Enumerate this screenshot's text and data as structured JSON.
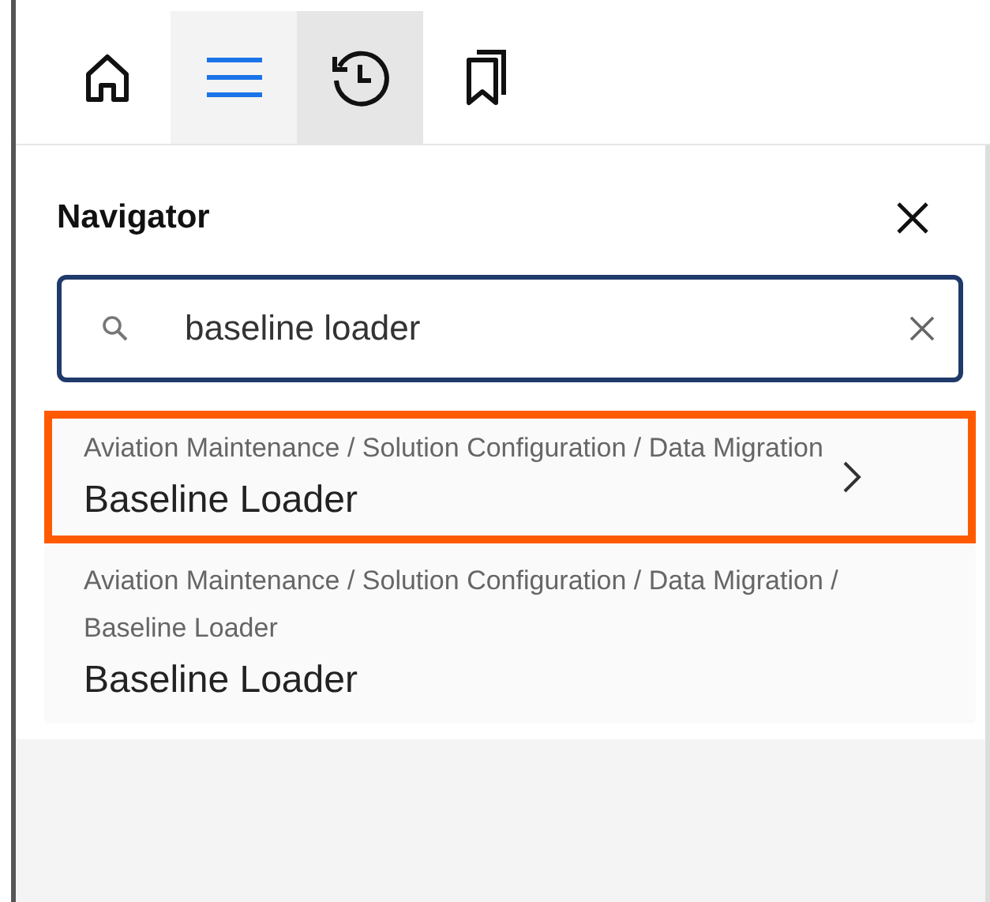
{
  "toolbar": {
    "tabs": [
      {
        "kind": "home",
        "selected": false,
        "hovered": false
      },
      {
        "kind": "menu",
        "selected": true,
        "hovered": false
      },
      {
        "kind": "history",
        "selected": false,
        "hovered": true
      },
      {
        "kind": "bookmarks",
        "selected": false,
        "hovered": false
      }
    ]
  },
  "navigator": {
    "title": "Navigator",
    "search": {
      "value": "baseline loader"
    },
    "results": [
      {
        "path": "Aviation Maintenance / Solution Configuration / Data Migration",
        "name": "Baseline Loader",
        "highlighted": true
      },
      {
        "path": "Aviation Maintenance / Solution Configuration / Data Migration / Baseline Loader",
        "name": "Baseline Loader",
        "highlighted": false
      }
    ]
  }
}
